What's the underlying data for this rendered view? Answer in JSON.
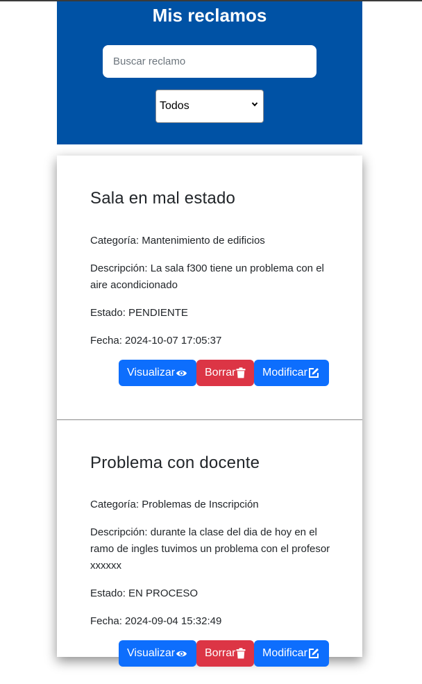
{
  "header": {
    "title": "Mis reclamos",
    "search_placeholder": "Buscar reclamo",
    "filter_value": "Todos"
  },
  "reclamos": [
    {
      "titulo": "Sala en mal estado",
      "categoria": "Categoría: Mantenimiento de edificios",
      "descripcion": "Descripción: La sala f300 tiene un problema con el aire acondicionado",
      "estado": "Estado: PENDIENTE",
      "fecha": "Fecha: 2024-10-07 17:05:37"
    },
    {
      "titulo": "Problema con docente",
      "categoria": "Categoría: Problemas de Inscripción",
      "descripcion": "Descripción: durante la clase del dia de hoy en el ramo de ingles tuvimos un problema con el profesor xxxxxx",
      "estado": "Estado: EN PROCESO",
      "fecha": "Fecha: 2024-09-04 15:32:49"
    }
  ],
  "buttons": {
    "visualizar": "Visualizar",
    "borrar": "Borrar",
    "modificar": "Modificar"
  },
  "icons": [
    "eye-icon",
    "trash-icon",
    "edit-icon",
    "chevron-down-icon"
  ],
  "colors": {
    "header_bg": "#0052a5",
    "primary": "#0d6efd",
    "danger": "#dc3545"
  }
}
